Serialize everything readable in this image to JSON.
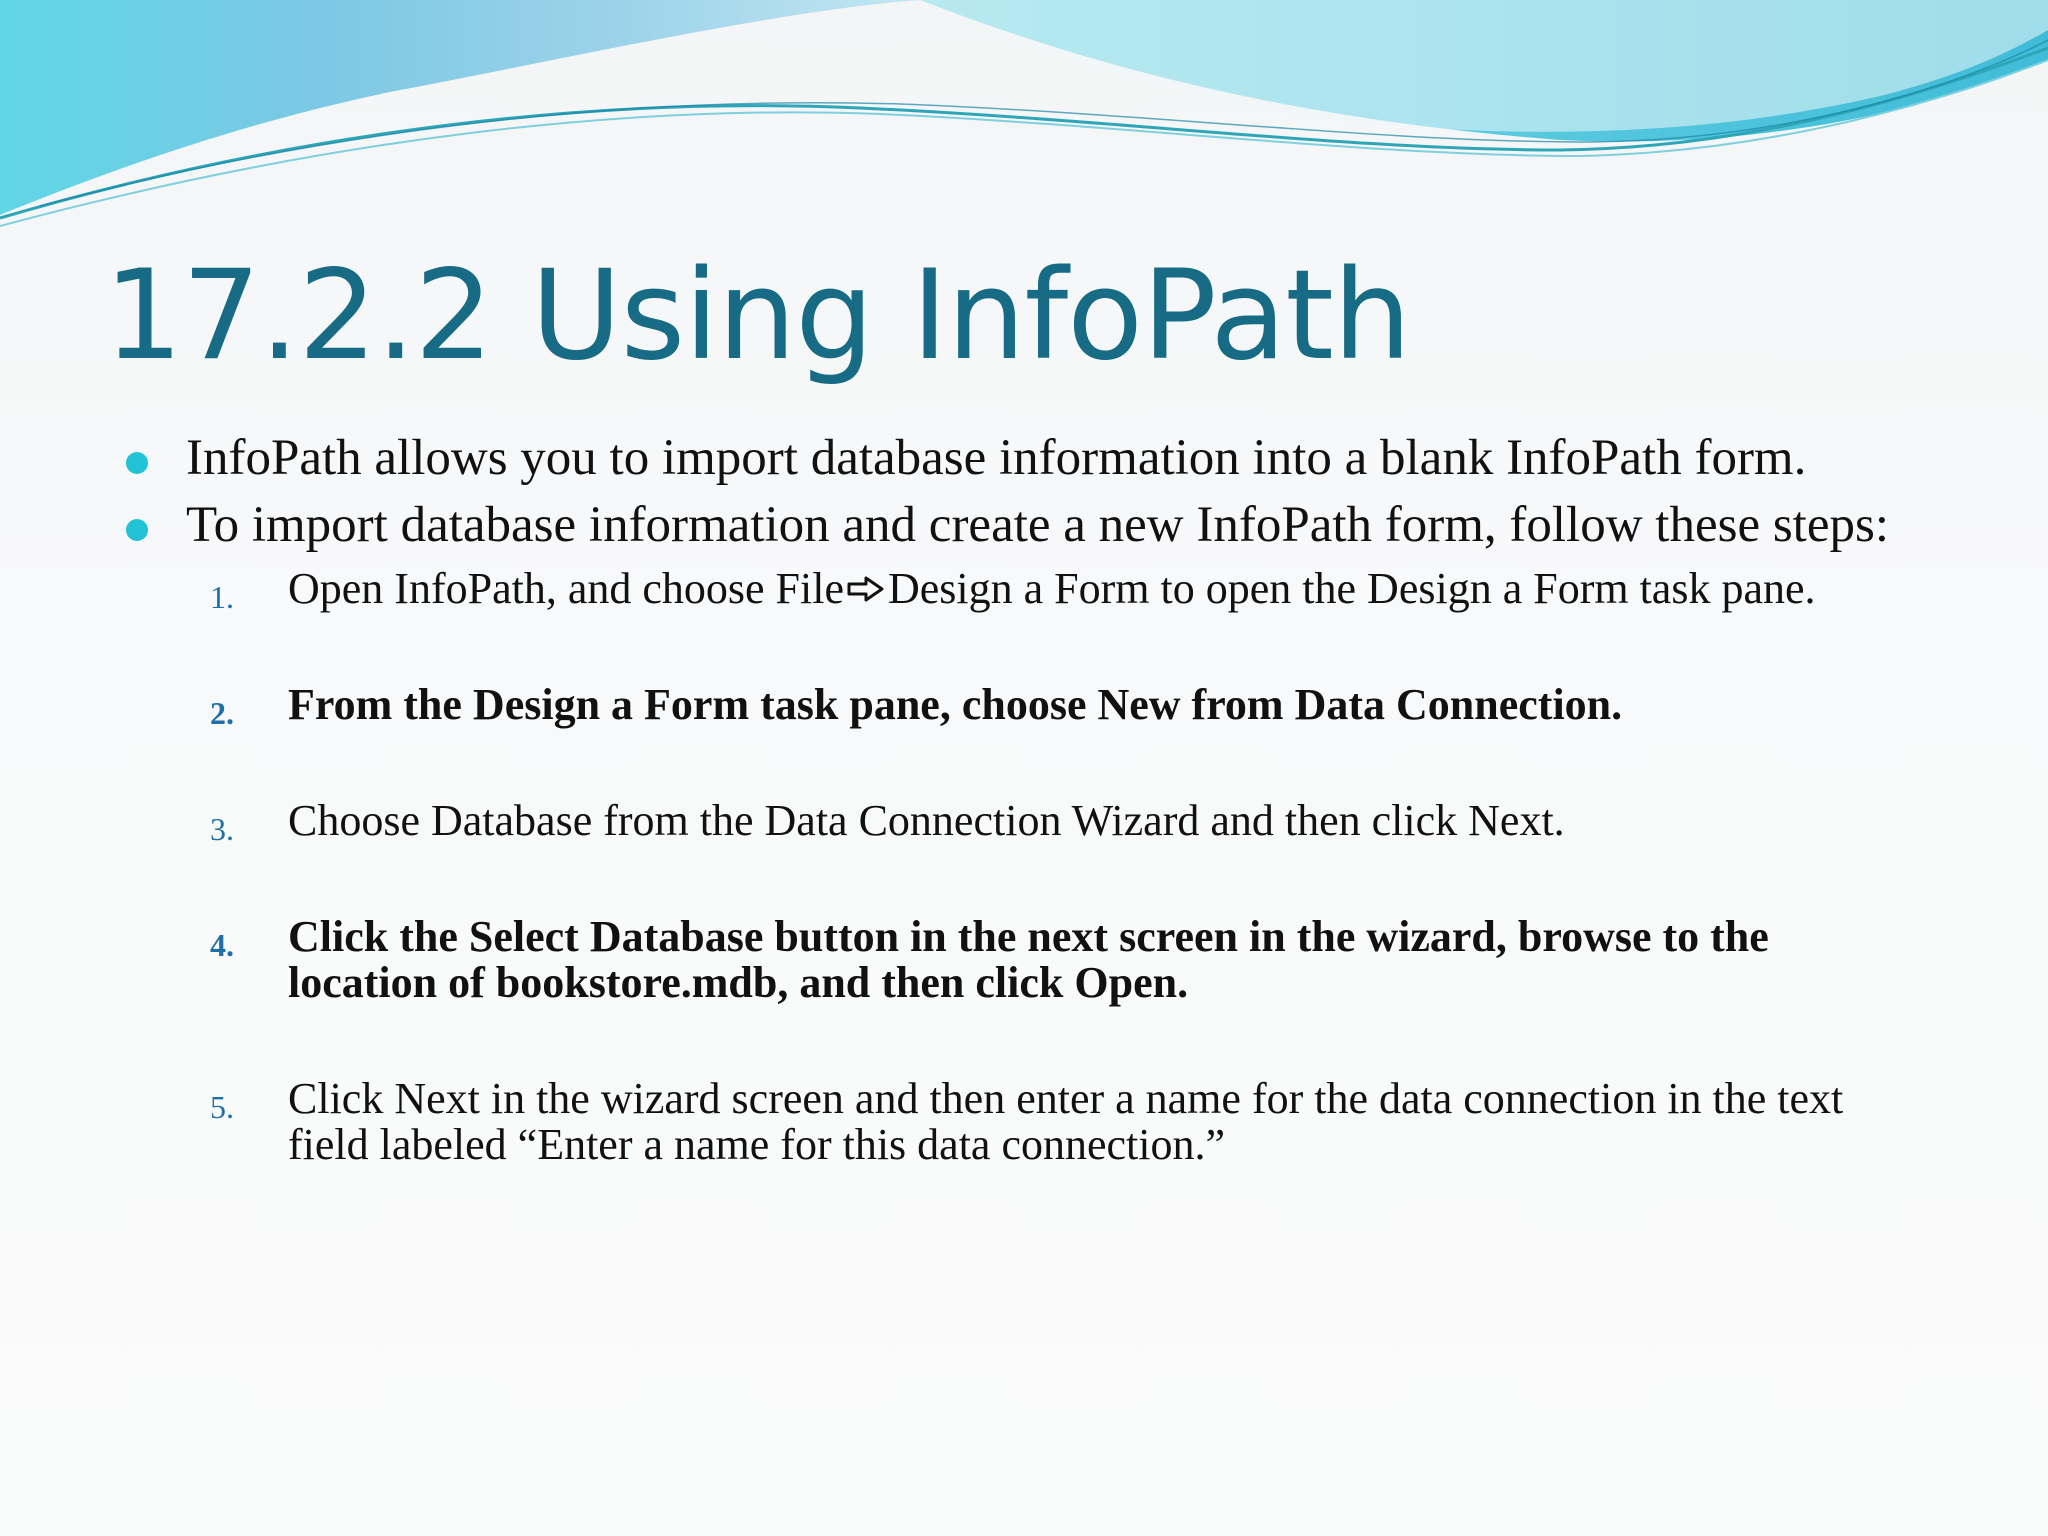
{
  "slide": {
    "title": "17.2.2 Using InfoPath",
    "bullets": [
      "InfoPath allows you to import database information into a blank InfoPath form.",
      "To import database information and create a new InfoPath form, follow these steps:"
    ],
    "steps": [
      {
        "number": "1.",
        "text_before": "Open InfoPath, and choose File",
        "icon": "arrow-right-icon",
        "text_after": "Design a Form to open the Design a Form task pane."
      },
      {
        "number": "2.",
        "text": "From the Design a Form task pane, choose New from Data Connection."
      },
      {
        "number": "3.",
        "text": "Choose Database from the Data Connection Wizard and then click Next."
      },
      {
        "number": "4.",
        "text": "Click the Select Database button in the next screen in the wizard, browse to the location of bookstore.mdb, and then click Open."
      },
      {
        "number": "5.",
        "text": "Click Next in the wizard screen and then enter a name for the data connection in the text field labeled “Enter a name for this data connection.”"
      }
    ]
  },
  "colors": {
    "title": "#176b84",
    "bullet": "#22c3d6",
    "step_number": "#1f6fa8",
    "body_text": "#111111"
  }
}
